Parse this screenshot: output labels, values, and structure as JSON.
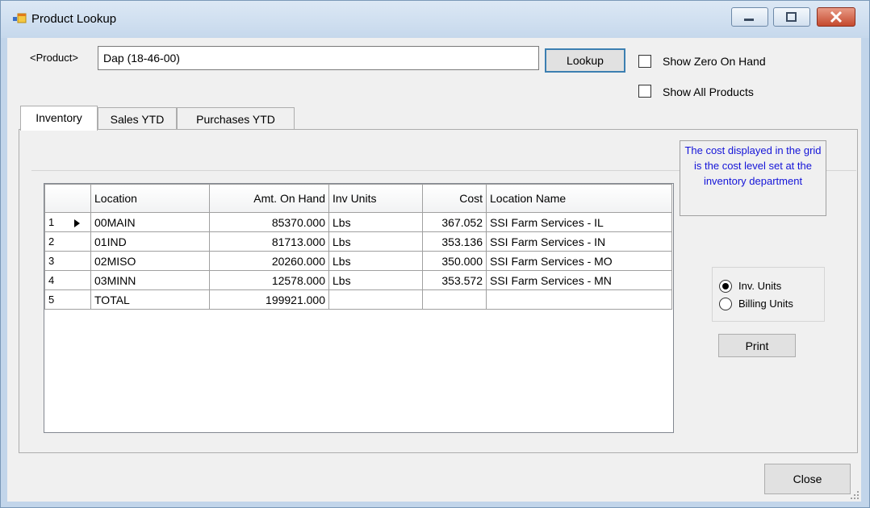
{
  "window": {
    "title": "Product Lookup"
  },
  "product": {
    "label": "<Product>",
    "value": "Dap (18-46-00)"
  },
  "buttons": {
    "lookup": "Lookup",
    "print": "Print",
    "close": "Close"
  },
  "options": {
    "show_zero_on_hand": "Show Zero On Hand",
    "show_all_products": "Show All Products"
  },
  "tabs": [
    {
      "label": "Inventory"
    },
    {
      "label": "Sales YTD"
    },
    {
      "label": "Purchases YTD"
    }
  ],
  "grid": {
    "headers": [
      "Location",
      "Amt. On Hand",
      "Inv Units",
      "Cost",
      "Location Name"
    ],
    "rows": [
      {
        "num": "1",
        "location": "00MAIN",
        "amt": "85370.000",
        "units": "Lbs",
        "cost": "367.052",
        "name": "SSI Farm Services - IL"
      },
      {
        "num": "2",
        "location": "01IND",
        "amt": "81713.000",
        "units": "Lbs",
        "cost": "353.136",
        "name": "SSI Farm Services - IN"
      },
      {
        "num": "3",
        "location": "02MISO",
        "amt": "20260.000",
        "units": "Lbs",
        "cost": "350.000",
        "name": "SSI Farm Services - MO"
      },
      {
        "num": "4",
        "location": "03MINN",
        "amt": "12578.000",
        "units": "Lbs",
        "cost": "353.572",
        "name": "SSI Farm Services - MN"
      },
      {
        "num": "5",
        "location": "TOTAL",
        "amt": "199921.000",
        "units": "",
        "cost": "",
        "name": ""
      }
    ]
  },
  "note": "The cost displayed in the grid is the cost level set at the inventory department",
  "units": {
    "inv": "Inv. Units",
    "billing": "Billing Units",
    "selected": "inv"
  },
  "colors": {
    "note_text": "#1414d8",
    "focus_border": "#3c7fb1",
    "close_button": "#c54a2e"
  },
  "icons": [
    "app-icon",
    "minimize-icon",
    "maximize-icon",
    "close-icon",
    "row-pointer-icon",
    "size-grip-icon"
  ]
}
